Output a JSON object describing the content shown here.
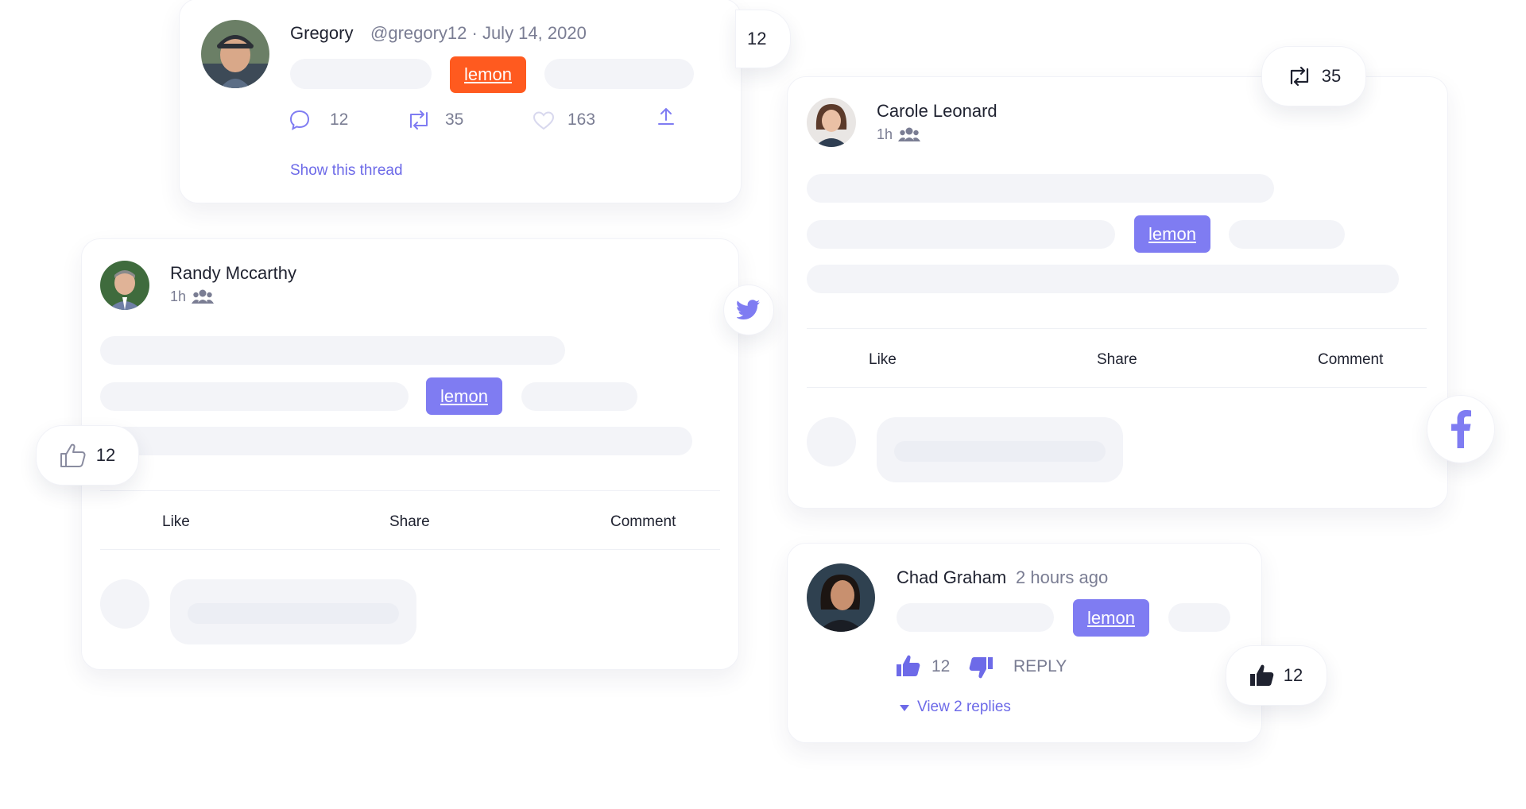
{
  "tweet_card": {
    "author_name": "Gregory",
    "meta": "@gregory12 · July 14, 2020",
    "tag_label": "lemon",
    "reply_count": "12",
    "retweet_count": "35",
    "like_count": "163",
    "thread_link": "Show this thread",
    "avatar_icon": "avatar-man-cap"
  },
  "float_badges": {
    "top_count": "12",
    "retweet_count": "35",
    "thumb_count": "12",
    "like_count_bottom": "12"
  },
  "fb_post_left": {
    "author_name": "Randy Mccarthy",
    "time": "1h",
    "audience_icon": "group-icon",
    "tag_label": "lemon",
    "actions": [
      "Like",
      "Share",
      "Comment"
    ]
  },
  "fb_post_right": {
    "author_name": "Carole Leonard",
    "time": "1h",
    "audience_icon": "group-icon",
    "tag_label": "lemon",
    "actions": [
      "Like",
      "Share",
      "Comment"
    ]
  },
  "youtube_comment": {
    "author_name": "Chad Graham",
    "time_ago": "2 hours ago",
    "tag_label": "lemon",
    "like_count": "12",
    "reply_label": "REPLY",
    "view_replies": "View 2 replies"
  },
  "colors": {
    "brand_purple": "#7f7cf2",
    "orange": "#ff5a1f",
    "skeleton": "#f3f4f8"
  }
}
